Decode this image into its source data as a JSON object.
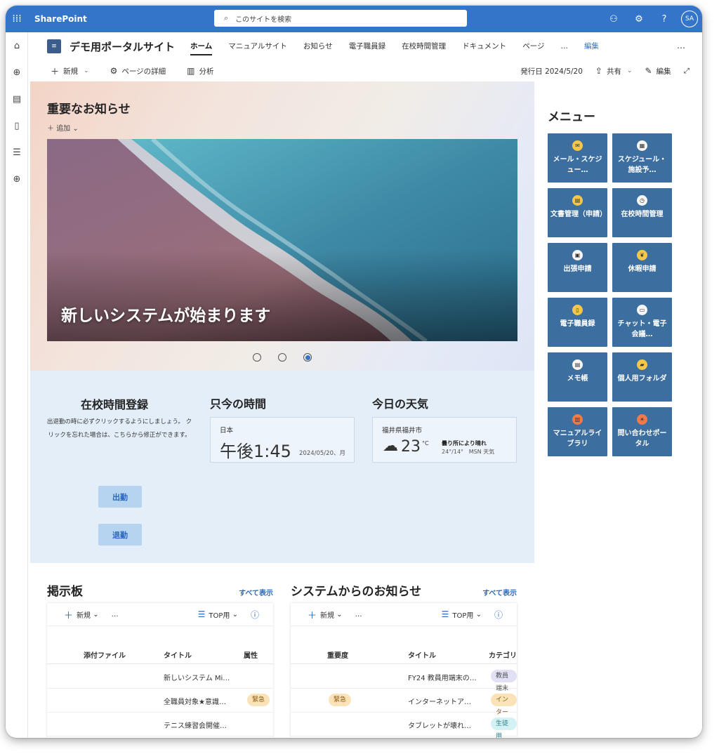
{
  "suite": {
    "app_name": "SharePoint",
    "search_placeholder": "このサイトを検索",
    "avatar_initials": "SA"
  },
  "site": {
    "title": "デモ用ポータルサイト",
    "nav": [
      "ホーム",
      "マニュアルサイト",
      "お知らせ",
      "電子職員録",
      "在校時間管理",
      "ドキュメント",
      "ページ",
      "…",
      "編集"
    ],
    "more": "…"
  },
  "command": {
    "new": "新規",
    "page_details": "ページの詳細",
    "analytics": "分析",
    "published": "発行日 2024/5/20",
    "share": "共有",
    "edit": "編集"
  },
  "hero": {
    "title": "重要なお知らせ",
    "add": "追加",
    "caption": "新しいシステムが始まります",
    "slides": 3,
    "active_slide": 3
  },
  "menu": {
    "title": "メニュー",
    "tiles": [
      {
        "label": "メール・スケジュー…",
        "icon": "envelope-icon"
      },
      {
        "label": "スケジュール・施設予…",
        "icon": "calendar-icon"
      },
      {
        "label": "文書管理（申請）",
        "icon": "document-icon"
      },
      {
        "label": "在校時間管理",
        "icon": "stopwatch-icon"
      },
      {
        "label": "出張申請",
        "icon": "briefcase-icon"
      },
      {
        "label": "休暇申請",
        "icon": "pineapple-icon"
      },
      {
        "label": "電子職員録",
        "icon": "clipboard-icon"
      },
      {
        "label": "チャット・電子会議…",
        "icon": "chat-icon"
      },
      {
        "label": "メモ帳",
        "icon": "notepad-icon"
      },
      {
        "label": "個人用フォルダ",
        "icon": "folder-icon"
      },
      {
        "label": "マニュアルライブラリ",
        "icon": "book-icon"
      },
      {
        "label": "問い合わせポータル",
        "icon": "lightbulb-icon"
      }
    ]
  },
  "attendance": {
    "title": "在校時間登録",
    "note": "出退勤の時に必ずクリックするようにしましょう。 クリックを忘れた場合は、こちらから修正ができます。",
    "clock_in": "出勤",
    "clock_out": "退勤"
  },
  "clock": {
    "title": "只今の時間",
    "location": "日本",
    "time": "午後1:45",
    "date": "2024/05/20、月"
  },
  "weather": {
    "title": "今日の天気",
    "location": "福井県福井市",
    "temp": "23",
    "unit": "°C",
    "condition": "曇り所により晴れ",
    "range": "24°/14°",
    "source": "MSN 天気"
  },
  "board": {
    "title": "掲示板",
    "show_all": "すべて表示",
    "new": "新規",
    "view": "TOP用",
    "columns": [
      "添付ファイル",
      "タイトル",
      "属性"
    ],
    "rows": [
      {
        "title": "新しいシステム Mi…",
        "tag": ""
      },
      {
        "title": "全職員対象★意識…",
        "tag": "緊急"
      },
      {
        "title": "テニス練習会開催…",
        "tag": ""
      }
    ]
  },
  "system": {
    "title": "システムからのお知らせ",
    "show_all": "すべて表示",
    "new": "新規",
    "view": "TOP用",
    "columns": [
      "重要度",
      "タイトル",
      "カテゴリ"
    ],
    "rows": [
      {
        "priority": "",
        "title": "FY24 教員用端末の…",
        "category": "教員端末"
      },
      {
        "priority": "緊急",
        "title": "インターネットア…",
        "category": "インター"
      },
      {
        "priority": "",
        "title": "タブレットが壊れ…",
        "category": "生徒用"
      }
    ]
  },
  "colors": {
    "suite_bar": "#3575c9",
    "tile": "#3c6e9f",
    "band": "#e3eef9",
    "link": "#2b69b8"
  }
}
